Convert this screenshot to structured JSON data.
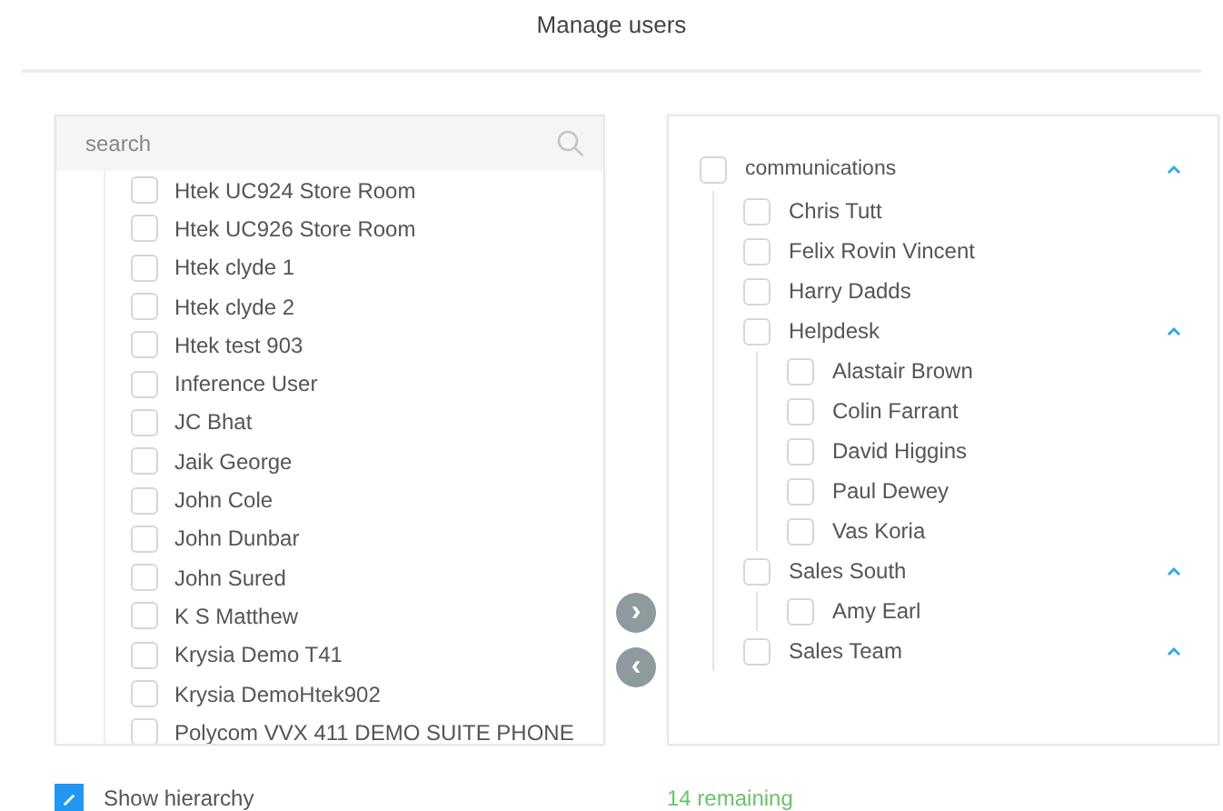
{
  "title": "Manage users",
  "search": {
    "placeholder": "search"
  },
  "available_users": [
    {
      "label": "Htek UC924 Store Room",
      "checked": false
    },
    {
      "label": "Htek UC926 Store Room",
      "checked": false
    },
    {
      "label": "Htek clyde 1",
      "checked": false
    },
    {
      "label": "Htek clyde 2",
      "checked": false
    },
    {
      "label": "Htek test 903",
      "checked": false
    },
    {
      "label": "Inference User",
      "checked": false
    },
    {
      "label": "JC Bhat",
      "checked": false
    },
    {
      "label": "Jaik George",
      "checked": false
    },
    {
      "label": "John Cole",
      "checked": false
    },
    {
      "label": "John Dunbar",
      "checked": false
    },
    {
      "label": "John Sured",
      "checked": false
    },
    {
      "label": "K S Matthew",
      "checked": false
    },
    {
      "label": "Krysia Demo T41",
      "checked": false
    },
    {
      "label": "Krysia DemoHtek902",
      "checked": false
    },
    {
      "label": "Polycom VVX 411 DEMO SUITE PHONE",
      "checked": false
    }
  ],
  "move_buttons": [
    {
      "label": "›",
      "disabled": true
    },
    {
      "label": "‹",
      "disabled": true
    }
  ],
  "selected_tree": [
    {
      "label": "communications",
      "checked": false,
      "expanded": true,
      "children": [
        {
          "label": "Chris Tutt",
          "checked": false
        },
        {
          "label": "Felix Rovin Vincent",
          "checked": false
        },
        {
          "label": "Harry Dadds",
          "checked": false
        },
        {
          "label": "Helpdesk",
          "checked": false,
          "expanded": true,
          "children": [
            {
              "label": "Alastair Brown",
              "checked": false
            },
            {
              "label": "Colin Farrant",
              "checked": false
            },
            {
              "label": "David Higgins",
              "checked": false
            },
            {
              "label": "Paul Dewey",
              "checked": false
            },
            {
              "label": "Vas Koria",
              "checked": false
            }
          ]
        },
        {
          "label": "Sales South",
          "checked": false,
          "expanded": true,
          "children": [
            {
              "label": "Amy Earl",
              "checked": false
            }
          ]
        },
        {
          "label": "Sales Team",
          "checked": false,
          "expanded": true
        }
      ]
    }
  ],
  "show_hierarchy": {
    "label": "Show hierarchy",
    "checked": true
  },
  "remaining": "14 remaining"
}
